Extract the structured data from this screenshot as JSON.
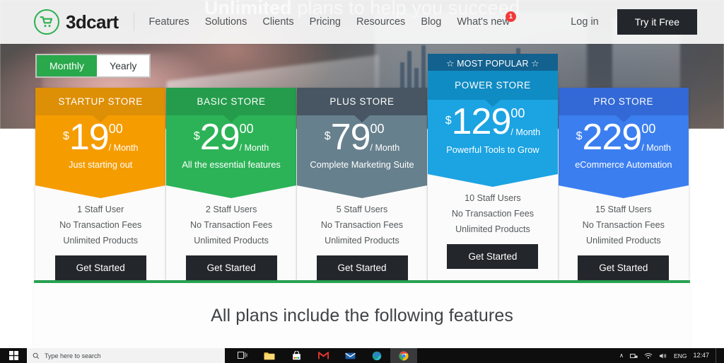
{
  "hero": {
    "headline_bold": "Unlimited",
    "headline_rest": " plans to help you succeed"
  },
  "navbar": {
    "logo_text": "3dcart",
    "logo_icon": "shopping-cart-icon",
    "links": [
      {
        "label": "Features"
      },
      {
        "label": "Solutions"
      },
      {
        "label": "Clients"
      },
      {
        "label": "Pricing"
      },
      {
        "label": "Resources"
      },
      {
        "label": "Blog"
      },
      {
        "label": "What's new",
        "badge": "1"
      }
    ],
    "login_label": "Log in",
    "cta_label": "Try it Free",
    "cta_color": "#23272b",
    "brand_green": "#2bb04e"
  },
  "billing_toggle": {
    "monthly_label": "Monthly",
    "yearly_label": "Yearly",
    "selected": "Monthly",
    "active_color": "#29a94b"
  },
  "plans": [
    {
      "name": "STARTUP STORE",
      "currency": "$",
      "amount": "19",
      "cents": "00",
      "period": "/ Month",
      "tagline": "Just starting out",
      "features": [
        "1 Staff User",
        "No Transaction Fees",
        "Unlimited Products"
      ],
      "cta_label": "Get Started",
      "color": "#f59c00",
      "header_color": "#dd8f06",
      "popular": false,
      "popular_label": ""
    },
    {
      "name": "BASIC STORE",
      "currency": "$",
      "amount": "29",
      "cents": "00",
      "period": "/ Month",
      "tagline": "All the essential features",
      "features": [
        "2 Staff Users",
        "No Transaction Fees",
        "Unlimited Products"
      ],
      "cta_label": "Get Started",
      "color": "#2cb357",
      "header_color": "#259c4c",
      "popular": false,
      "popular_label": ""
    },
    {
      "name": "PLUS STORE",
      "currency": "$",
      "amount": "79",
      "cents": "00",
      "period": "/ Month",
      "tagline": "Complete Marketing Suite",
      "features": [
        "5 Staff Users",
        "No Transaction Fees",
        "Unlimited Products"
      ],
      "cta_label": "Get Started",
      "color": "#67808d",
      "header_color": "#475662",
      "popular": false,
      "popular_label": ""
    },
    {
      "name": "POWER STORE",
      "currency": "$",
      "amount": "129",
      "cents": "00",
      "period": "/ Month",
      "tagline": "Powerful Tools to Grow",
      "features": [
        "10 Staff Users",
        "No Transaction Fees",
        "Unlimited Products"
      ],
      "cta_label": "Get Started",
      "color": "#1ba3e2",
      "header_color": "#0f8cc4",
      "popular": true,
      "popular_label": "☆ MOST POPULAR ☆",
      "popular_color": "#12618f"
    },
    {
      "name": "PRO STORE",
      "currency": "$",
      "amount": "229",
      "cents": "00",
      "period": "/ Month",
      "tagline": "eCommerce Automation",
      "features": [
        "15 Staff Users",
        "No Transaction Fees",
        "Unlimited Products"
      ],
      "cta_label": "Get Started",
      "color": "#3b7ef0",
      "header_color": "#3369d6",
      "popular": false,
      "popular_label": ""
    }
  ],
  "features_section": {
    "title": "All plans include the following features",
    "rule_color": "#2bab57"
  },
  "taskbar": {
    "start_icon": "windows-start-icon",
    "search_placeholder": "Type here to search",
    "search_icon": "search-icon",
    "icons": [
      {
        "name": "task-view-icon"
      },
      {
        "name": "file-explorer-icon"
      },
      {
        "name": "microsoft-store-icon"
      },
      {
        "name": "gmail-icon"
      },
      {
        "name": "mail-icon"
      },
      {
        "name": "edge-icon"
      },
      {
        "name": "chrome-icon"
      }
    ],
    "tray": {
      "chevron": "∧",
      "network_icon": "network-icon",
      "wifi_icon": "wifi-icon",
      "volume_icon": "volume-icon",
      "language": "ENG",
      "time": "12:47"
    }
  }
}
